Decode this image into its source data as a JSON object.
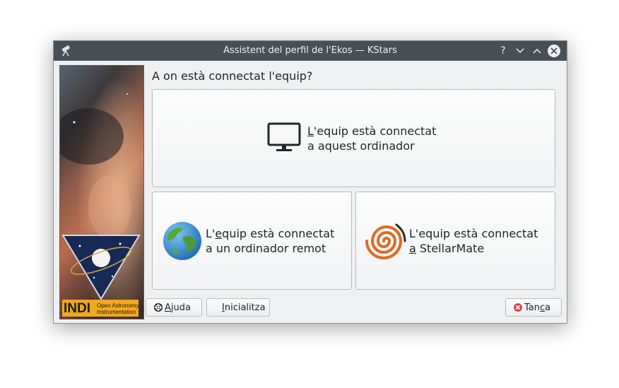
{
  "window": {
    "title": "Assistent del perfil de l'Ekos — KStars"
  },
  "titlebar_buttons": {
    "help": "?",
    "minimize": "⌄",
    "maximize": "⌃",
    "close": "✕"
  },
  "side_image": {
    "logo_text": "INDI",
    "logo_sub1": "Open Astronomy",
    "logo_sub2": "Instrumentation"
  },
  "question": "A on està connectat l'equip?",
  "options": {
    "local": {
      "line1_key": "L",
      "line1_rest": "'equip està connectat",
      "line2": "a aquest ordinador"
    },
    "remote": {
      "line1_pre": "L'",
      "line1_key": "e",
      "line1_rest": "quip està connectat",
      "line2": "a un ordinador remot"
    },
    "stellarmate": {
      "line1": "L'equip està connectat",
      "line2_key": "a",
      "line2_rest": " StellarMate"
    }
  },
  "buttons": {
    "help": {
      "key": "A",
      "rest": "juda"
    },
    "reset": {
      "key": "I",
      "rest": "nicialitza"
    },
    "cancel": {
      "pre": "Tan",
      "key": "c",
      "rest": "a"
    }
  },
  "colors": {
    "titlebar": "#475057",
    "window_bg": "#eff0f1",
    "close_red": "#da4453"
  }
}
